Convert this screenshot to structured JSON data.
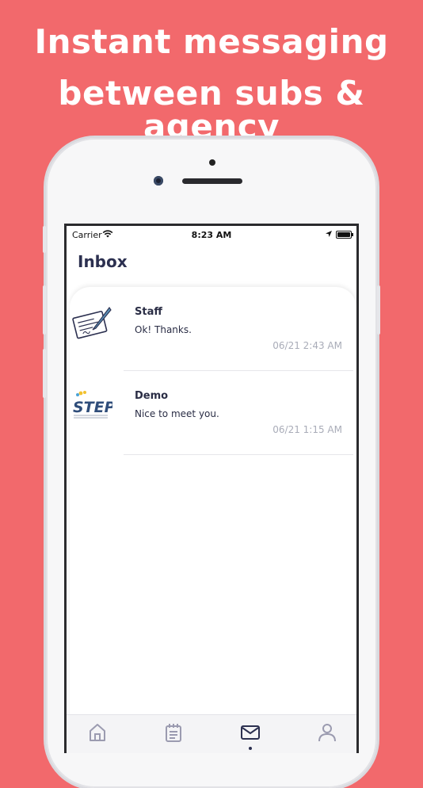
{
  "headline": {
    "line1": "Instant messaging",
    "line2": "between subs & agency"
  },
  "status_bar": {
    "carrier": "Carrier",
    "time": "8:23 AM"
  },
  "page_title": "Inbox",
  "messages": [
    {
      "sender": "Staff",
      "preview": "Ok! Thanks.",
      "timestamp": "06/21 2:43 AM",
      "avatar": "signature-document-icon"
    },
    {
      "sender": "Demo",
      "preview": "Nice to meet you.",
      "timestamp": "06/21 1:15 AM",
      "avatar": "step-logo"
    }
  ],
  "avatar_logo_text": "STEP",
  "tab_bar": {
    "items": [
      {
        "icon": "home-icon"
      },
      {
        "icon": "notepad-icon"
      },
      {
        "icon": "mail-icon",
        "active": true
      },
      {
        "icon": "user-icon"
      }
    ]
  },
  "colors": {
    "background": "#f2696c",
    "text_dark": "#2c3050",
    "timestamp": "#a9acb8",
    "tab_inactive": "#9b9bb0"
  }
}
